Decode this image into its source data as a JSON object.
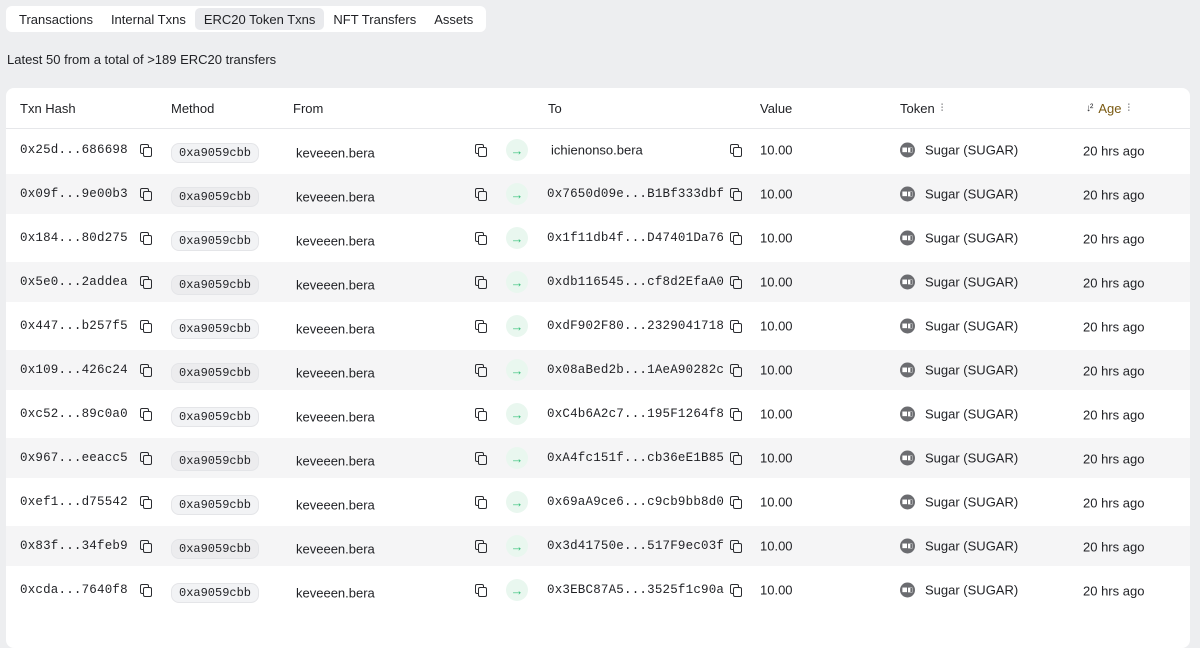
{
  "tabs": [
    {
      "label": "Transactions",
      "active": false
    },
    {
      "label": "Internal Txns",
      "active": false
    },
    {
      "label": "ERC20 Token Txns",
      "active": true
    },
    {
      "label": "NFT Transfers",
      "active": false
    },
    {
      "label": "Assets",
      "active": false
    }
  ],
  "summary": "Latest 50 from a total of >189 ERC20 transfers",
  "columns": {
    "hash": "Txn Hash",
    "method": "Method",
    "from": "From",
    "to": "To",
    "value": "Value",
    "token": "Token",
    "age": "Age",
    "age_sort_glyph": "↓²",
    "filter_glyph": "⫶"
  },
  "transfer_arrow": "→",
  "token_icon_text": "■◧",
  "rows": [
    {
      "hash": "0x25d...686698",
      "method": "0xa9059cbb",
      "from": "keveeen.bera",
      "to": "ichienonso.bera",
      "value": "10.00",
      "token": "Sugar (SUGAR)",
      "age": "20 hrs ago"
    },
    {
      "hash": "0x09f...9e00b3",
      "method": "0xa9059cbb",
      "from": "keveeen.bera",
      "to": "0x7650d09e...B1Bf333dbf",
      "value": "10.00",
      "token": "Sugar (SUGAR)",
      "age": "20 hrs ago"
    },
    {
      "hash": "0x184...80d275",
      "method": "0xa9059cbb",
      "from": "keveeen.bera",
      "to": "0x1f11db4f...D47401Da76",
      "value": "10.00",
      "token": "Sugar (SUGAR)",
      "age": "20 hrs ago"
    },
    {
      "hash": "0x5e0...2addea",
      "method": "0xa9059cbb",
      "from": "keveeen.bera",
      "to": "0xdb116545...cf8d2EfaA0",
      "value": "10.00",
      "token": "Sugar (SUGAR)",
      "age": "20 hrs ago"
    },
    {
      "hash": "0x447...b257f5",
      "method": "0xa9059cbb",
      "from": "keveeen.bera",
      "to": "0xdF902F80...2329041718",
      "value": "10.00",
      "token": "Sugar (SUGAR)",
      "age": "20 hrs ago"
    },
    {
      "hash": "0x109...426c24",
      "method": "0xa9059cbb",
      "from": "keveeen.bera",
      "to": "0x08aBed2b...1AeA90282c",
      "value": "10.00",
      "token": "Sugar (SUGAR)",
      "age": "20 hrs ago"
    },
    {
      "hash": "0xc52...89c0a0",
      "method": "0xa9059cbb",
      "from": "keveeen.bera",
      "to": "0xC4b6A2c7...195F1264f8",
      "value": "10.00",
      "token": "Sugar (SUGAR)",
      "age": "20 hrs ago"
    },
    {
      "hash": "0x967...eeacc5",
      "method": "0xa9059cbb",
      "from": "keveeen.bera",
      "to": "0xA4fc151f...cb36eE1B85",
      "value": "10.00",
      "token": "Sugar (SUGAR)",
      "age": "20 hrs ago"
    },
    {
      "hash": "0xef1...d75542",
      "method": "0xa9059cbb",
      "from": "keveeen.bera",
      "to": "0x69aA9ce6...c9cb9bb8d0",
      "value": "10.00",
      "token": "Sugar (SUGAR)",
      "age": "20 hrs ago"
    },
    {
      "hash": "0x83f...34feb9",
      "method": "0xa9059cbb",
      "from": "keveeen.bera",
      "to": "0x3d41750e...517F9ec03f",
      "value": "10.00",
      "token": "Sugar (SUGAR)",
      "age": "20 hrs ago"
    },
    {
      "hash": "0xcda...7640f8",
      "method": "0xa9059cbb",
      "from": "keveeen.bera",
      "to": "0x3EBC87A5...3525f1c90a",
      "value": "10.00",
      "token": "Sugar (SUGAR)",
      "age": "20 hrs ago"
    }
  ],
  "colors": {
    "accent_green": "#35c07a",
    "row_alt": "#f5f5f6",
    "page_bg": "#edeef0"
  }
}
